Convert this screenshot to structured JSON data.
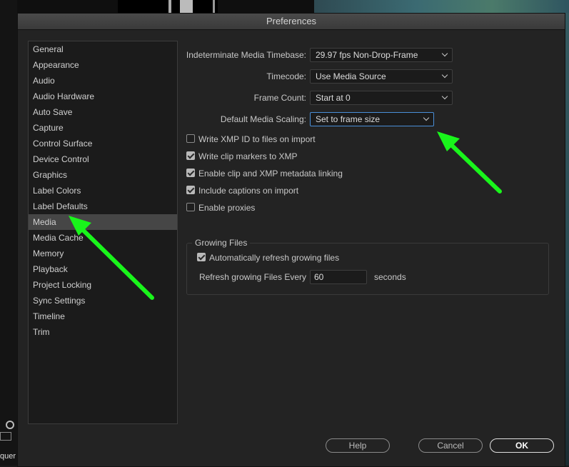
{
  "background": {
    "bottom_text": "quer"
  },
  "dialog": {
    "title": "Preferences",
    "sidebar": {
      "selected": "Media",
      "items": [
        {
          "label": "General"
        },
        {
          "label": "Appearance"
        },
        {
          "label": "Audio"
        },
        {
          "label": "Audio Hardware"
        },
        {
          "label": "Auto Save"
        },
        {
          "label": "Capture"
        },
        {
          "label": "Control Surface"
        },
        {
          "label": "Device Control"
        },
        {
          "label": "Graphics"
        },
        {
          "label": "Label Colors"
        },
        {
          "label": "Label Defaults"
        },
        {
          "label": "Media"
        },
        {
          "label": "Media Cache"
        },
        {
          "label": "Memory"
        },
        {
          "label": "Playback"
        },
        {
          "label": "Project Locking"
        },
        {
          "label": "Sync Settings"
        },
        {
          "label": "Timeline"
        },
        {
          "label": "Trim"
        }
      ]
    },
    "fields": {
      "timebase": {
        "label": "Indeterminate Media Timebase:",
        "value": "29.97 fps Non-Drop-Frame"
      },
      "timecode": {
        "label": "Timecode:",
        "value": "Use Media Source"
      },
      "frame_count": {
        "label": "Frame Count:",
        "value": "Start at 0"
      },
      "scaling": {
        "label": "Default Media Scaling:",
        "value": "Set to frame size"
      }
    },
    "checkboxes": {
      "xmp_id": {
        "label": "Write XMP ID to files on import",
        "checked": false
      },
      "clip_markers": {
        "label": "Write clip markers to XMP",
        "checked": true
      },
      "metadata_linking": {
        "label": "Enable clip and XMP metadata linking",
        "checked": true
      },
      "captions": {
        "label": "Include captions on import",
        "checked": true
      },
      "proxies": {
        "label": "Enable proxies",
        "checked": false
      }
    },
    "growing_files": {
      "title": "Growing Files",
      "auto_refresh": {
        "label": "Automatically refresh growing files",
        "checked": true
      },
      "refresh_label": "Refresh growing Files Every",
      "refresh_value": "60",
      "refresh_unit": "seconds"
    },
    "buttons": {
      "help": "Help",
      "cancel": "Cancel",
      "ok": "OK"
    }
  },
  "annotation_color": "#19f51b"
}
